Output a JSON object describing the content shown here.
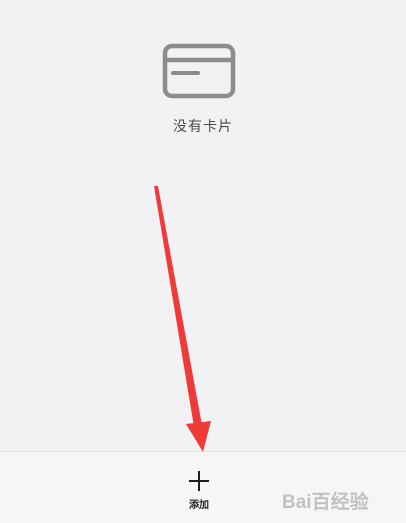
{
  "empty_state": {
    "icon": "credit-card-icon",
    "message": "没有卡片"
  },
  "toolbar": {
    "add_icon": "plus-icon",
    "add_label": "添加"
  },
  "annotation": {
    "type": "arrow",
    "color": "#f03a3a"
  },
  "watermark": {
    "text": "Bai百经验"
  },
  "colors": {
    "background": "#f2f2f4",
    "icon_gray": "#8c8c8c",
    "text": "#4a4a4a"
  }
}
